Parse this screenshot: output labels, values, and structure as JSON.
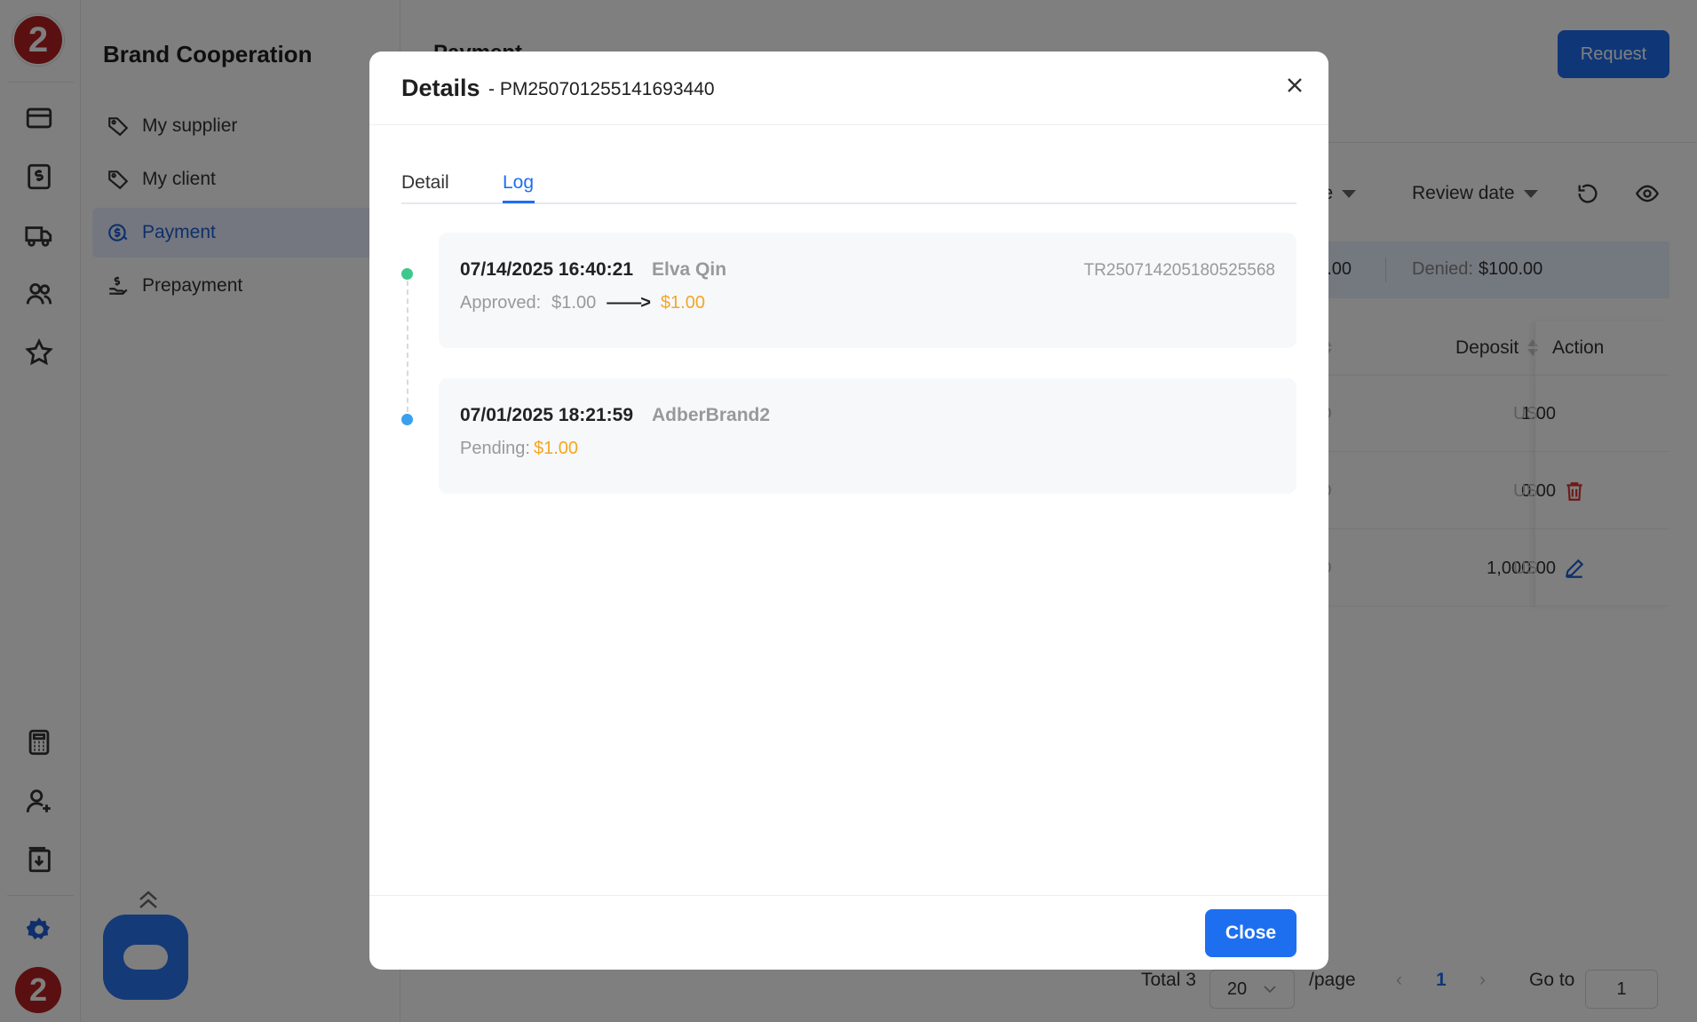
{
  "rail": {
    "logo_text": "2",
    "bottom_logo_text": "2",
    "icons": [
      "card-icon",
      "dollar-doc-icon",
      "truck-icon",
      "users-icon",
      "star-icon",
      "calculator-icon",
      "user-add-icon",
      "download-doc-icon",
      "gear-icon"
    ]
  },
  "sidebar": {
    "title": "Brand Cooperation",
    "items": [
      {
        "label": "My supplier",
        "icon": "tag-icon",
        "active": false
      },
      {
        "label": "My client",
        "icon": "tag-icon",
        "active": false
      },
      {
        "label": "Payment",
        "icon": "dollar-circle-icon",
        "active": true
      },
      {
        "label": "Prepayment",
        "icon": "hand-coin-icon",
        "active": false
      }
    ]
  },
  "main": {
    "page_title": "Payment",
    "request_label": "Request",
    "filters": {
      "date_fragment": "ate",
      "review_date": "Review date"
    },
    "summary": {
      "amount_fragment": "00.00",
      "denied_label": "Denied:",
      "denied_value": "$100.00"
    },
    "table": {
      "headers": {
        "deposit": "Deposit",
        "action": "Action"
      },
      "rows": [
        {
          "currency_fragment": "SD",
          "deposit": "1.00",
          "unit_fragment": "US",
          "action_icon": ""
        },
        {
          "currency_fragment": "SD",
          "deposit": "0.00",
          "unit_fragment": "US",
          "action_icon": "trash-icon"
        },
        {
          "currency_fragment": "SD",
          "deposit": "1,000.00",
          "unit_fragment": "US",
          "action_icon": "edit-icon"
        }
      ]
    },
    "pagination": {
      "total": "Total 3",
      "page_size": "20",
      "per_page": "/page",
      "current_page": "1",
      "goto_label": "Go to",
      "goto_value": "1"
    }
  },
  "modal": {
    "title": "Details",
    "id": "- PM250701255141693440",
    "tabs": [
      {
        "label": "Detail",
        "active": false
      },
      {
        "label": "Log",
        "active": true
      }
    ],
    "logs": [
      {
        "timestamp": "07/14/2025 16:40:21",
        "user": "Elva Qin",
        "ref": "TR250714205180525568",
        "status": "Approved:",
        "from": "$1.00",
        "arrow": "——>",
        "to": "$1.00",
        "dot_color": "#3ec98a"
      },
      {
        "timestamp": "07/01/2025 18:21:59",
        "user": "AdberBrand2",
        "status": "Pending:",
        "to": "$1.00",
        "dot_color": "#3aa0f0"
      }
    ],
    "close_label": "Close"
  },
  "colors": {
    "accent": "#1e6ff0",
    "amount": "#f5a623",
    "logo": "#b52020",
    "overlay": "rgba(0,0,0,0.5)"
  }
}
